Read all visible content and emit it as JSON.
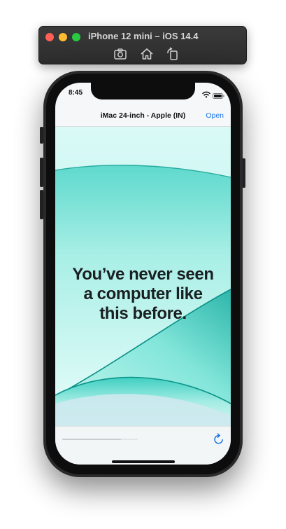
{
  "simulator": {
    "title": "iPhone 12 mini – iOS 14.4",
    "toolbar_icons": [
      "screenshot-icon",
      "home-icon",
      "rotate-icon"
    ]
  },
  "status_bar": {
    "time": "8:45",
    "icons": [
      "wifi-icon",
      "battery-icon"
    ]
  },
  "browser": {
    "page_title": "iMac 24-inch - Apple (IN)",
    "open_label": "Open",
    "load_progress": 0.78,
    "reload_icon": "reload-icon"
  },
  "hero": {
    "headline_line1": "You’ve never seen",
    "headline_line2": "a computer like",
    "headline_line3": "this before."
  },
  "colors": {
    "link": "#1a73e8",
    "teal_bright": "#6fe8da",
    "teal_dark": "#0a8f86",
    "headline": "#1a1f22"
  }
}
